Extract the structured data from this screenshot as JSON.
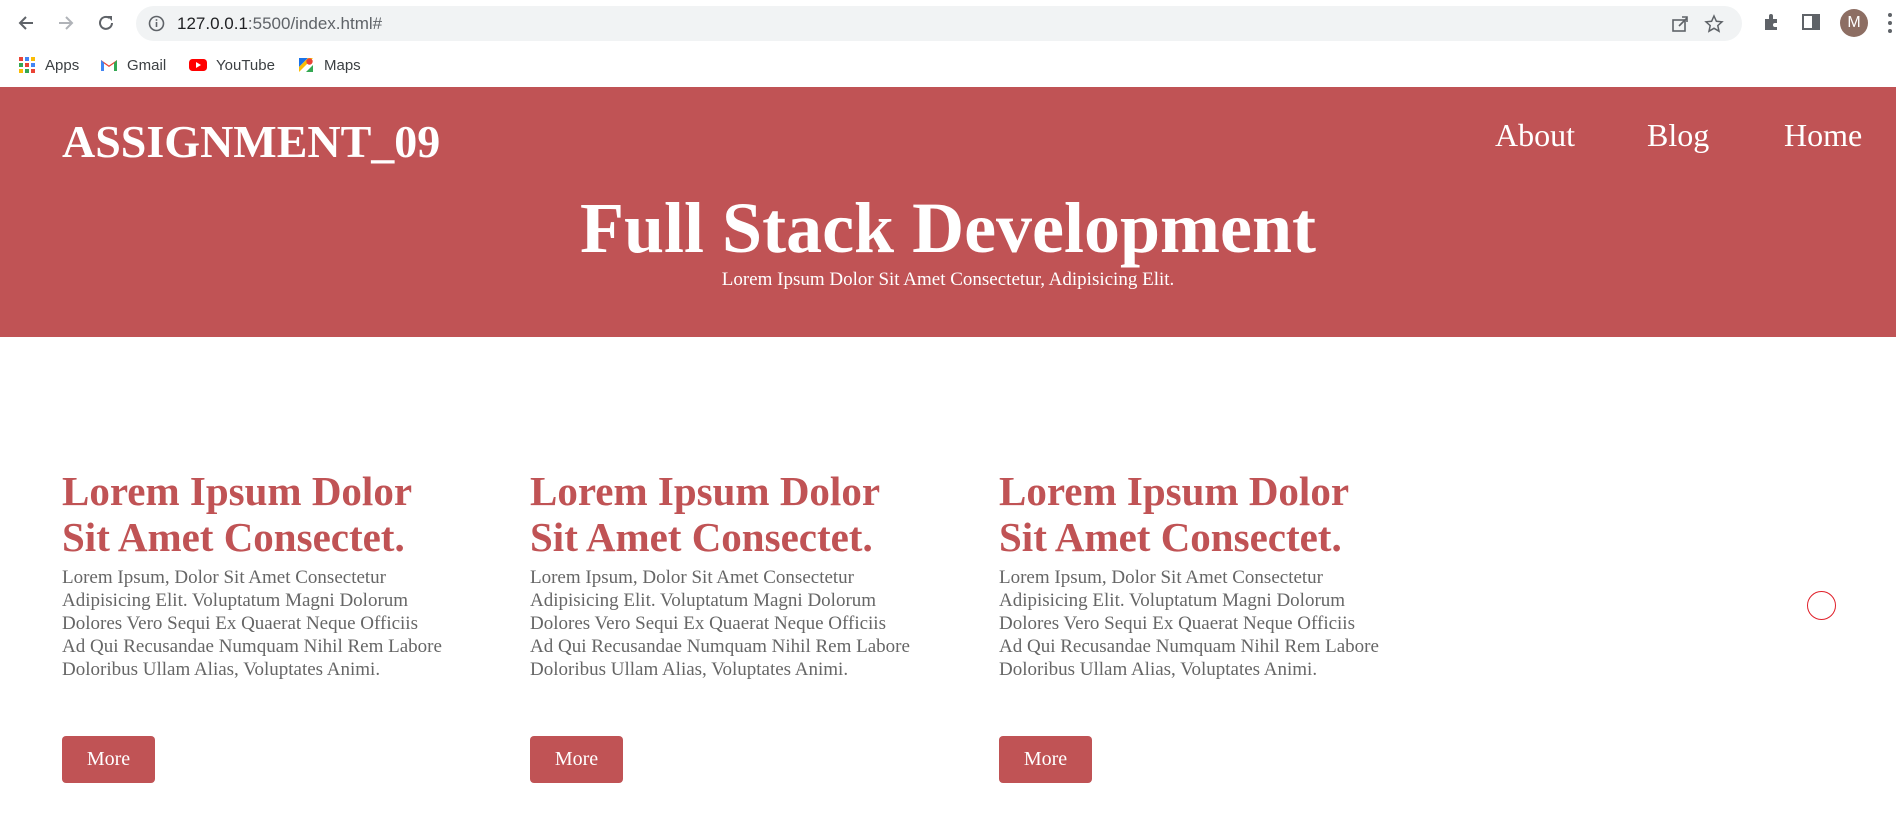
{
  "browser": {
    "url_host": "127.0.0.1",
    "url_rest": ":5500/index.html#",
    "profile_initial": "M",
    "bookmarks": [
      {
        "label": "Apps",
        "icon": "apps-grid-icon"
      },
      {
        "label": "Gmail",
        "icon": "gmail-icon"
      },
      {
        "label": "YouTube",
        "icon": "youtube-icon"
      },
      {
        "label": "Maps",
        "icon": "maps-icon"
      }
    ]
  },
  "header": {
    "brand": "ASSIGNMENT_09",
    "nav": [
      "About",
      "Blog",
      "Home"
    ],
    "title": "Full Stack Development",
    "subtitle": "Lorem Ipsum Dolor Sit Amet Consectetur, Adipisicing Elit."
  },
  "cards": [
    {
      "title": "Lorem Ipsum Dolor Sit Amet Consectet.",
      "body": "Lorem Ipsum, Dolor Sit Amet Consectetur Adipisicing Elit. Voluptatum Magni Dolorum Dolores Vero Sequi Ex Quaerat Neque Officiis Ad Qui Recusandae Numquam Nihil Rem Labore Doloribus Ullam Alias, Voluptates Animi.",
      "button": "More"
    },
    {
      "title": "Lorem Ipsum Dolor Sit Amet Consectet.",
      "body": "Lorem Ipsum, Dolor Sit Amet Consectetur Adipisicing Elit. Voluptatum Magni Dolorum Dolores Vero Sequi Ex Quaerat Neque Officiis Ad Qui Recusandae Numquam Nihil Rem Labore Doloribus Ullam Alias, Voluptates Animi.",
      "button": "More"
    },
    {
      "title": "Lorem Ipsum Dolor Sit Amet Consectet.",
      "body": "Lorem Ipsum, Dolor Sit Amet Consectetur Adipisicing Elit. Voluptatum Magni Dolorum Dolores Vero Sequi Ex Quaerat Neque Officiis Ad Qui Recusandae Numquam Nihil Rem Labore Doloribus Ullam Alias, Voluptates Animi.",
      "button": "More"
    }
  ],
  "colors": {
    "accent": "#c05355",
    "body_text": "#666666"
  }
}
